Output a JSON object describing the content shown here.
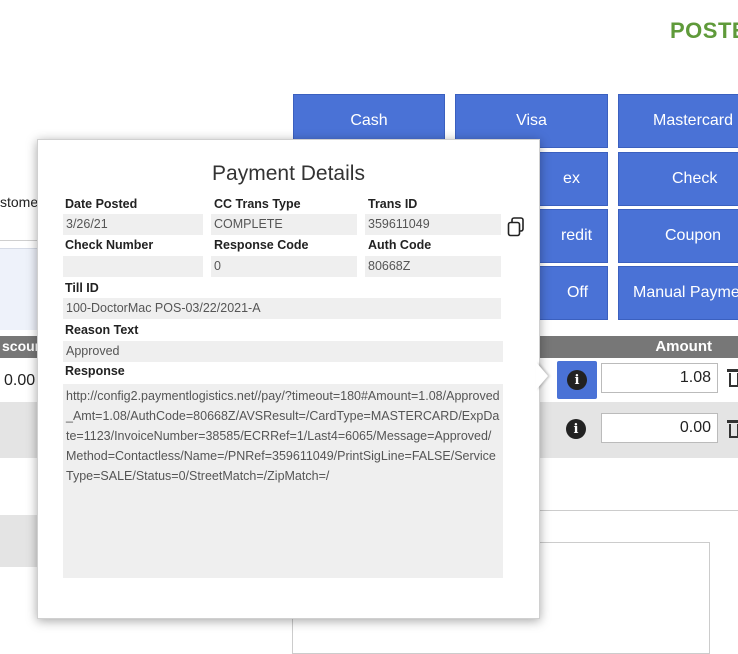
{
  "header": {
    "title": "POSTE"
  },
  "left_panel": {
    "customer_label": "stome",
    "discount_header": "scoun",
    "discount_value": "0.00"
  },
  "payment_buttons": {
    "cash": "Cash",
    "visa": "Visa",
    "mastercard": "Mastercard",
    "amex": "ex",
    "check": "Check",
    "credit": "redit",
    "coupon": "Coupon",
    "off": "Off",
    "manual_payment": "Manual Payme"
  },
  "payments_table": {
    "amount_header": "Amount",
    "rows": [
      {
        "amount": "1.08",
        "icon": "info-icon"
      },
      {
        "amount": "0.00",
        "icon": "info-icon"
      }
    ]
  },
  "popover": {
    "title": "Payment Details",
    "fields": {
      "date_posted": {
        "label": "Date Posted",
        "value": "3/26/21"
      },
      "cc_trans_type": {
        "label": "CC Trans Type",
        "value": "COMPLETE"
      },
      "trans_id": {
        "label": "Trans ID",
        "value": "359611049"
      },
      "check_number": {
        "label": "Check Number",
        "value": ""
      },
      "response_code": {
        "label": "Response Code",
        "value": "0"
      },
      "auth_code": {
        "label": "Auth Code",
        "value": "80668Z"
      },
      "till_id": {
        "label": "Till ID",
        "value": "100-DoctorMac POS-03/22/2021-A"
      },
      "reason_text": {
        "label": "Reason Text",
        "value": "Approved"
      },
      "response": {
        "label": "Response",
        "value": "http://config2.paymentlogistics.net//pay/?timeout=180#Amount=1.08/Approved_Amt=1.08/AuthCode=80668Z/AVSResult=/CardType=MASTERCARD/ExpDate=1123/InvoiceNumber=38585/ECRRef=1/Last4=6065/Message=Approved/Method=Contactless/Name=/PNRef=359611049/PrintSigLine=FALSE/ServiceType=SALE/Status=0/StreetMatch=/ZipMatch=/"
      }
    },
    "copy_icon": "copy-icon"
  }
}
